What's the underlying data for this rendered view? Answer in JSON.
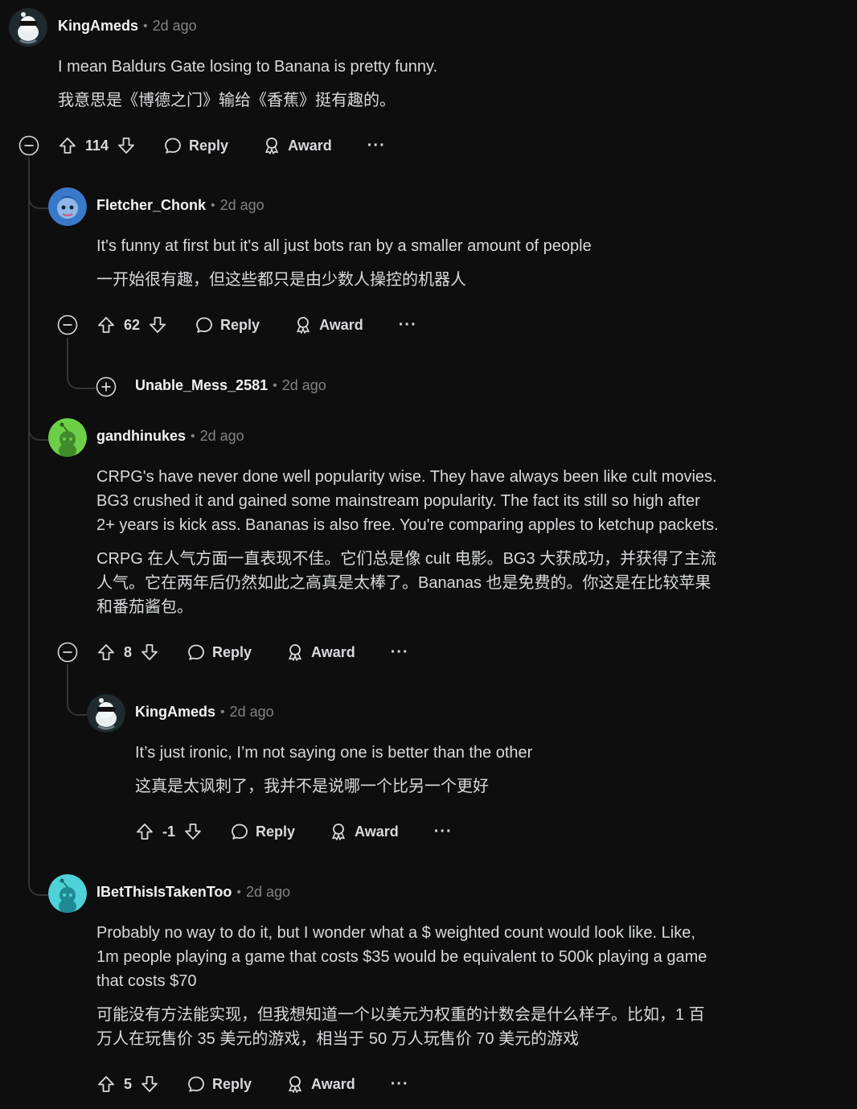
{
  "comments": [
    {
      "user": "KingAmeds",
      "time": "2d ago",
      "text": "I mean Baldurs Gate losing to Banana is pretty funny.",
      "translation": "我意思是《博德之门》输给《香蕉》挺有趣的。",
      "score": "114"
    },
    {
      "user": "Fletcher_Chonk",
      "time": "2d ago",
      "text": "It's funny at first but it's all just bots ran by a smaller amount of people",
      "translation": "一开始很有趣，但这些都只是由少数人操控的机器人",
      "score": "62"
    },
    {
      "user": "Unable_Mess_2581",
      "time": "2d ago"
    },
    {
      "user": "gandhinukes",
      "time": "2d ago",
      "text": [
        "CRPG's have never done well popularity wise. They have always been like cult movies.",
        "BG3 crushed it and gained some mainstream popularity. The fact its still so high after",
        "2+ years is kick ass. Bananas is also free. You're comparing apples to ketchup packets."
      ],
      "translation": [
        "CRPG 在人气方面一直表现不佳。它们总是像 cult 电影。BG3 大获成功，并获得了主流",
        "人气。它在两年后仍然如此之高真是太棒了。Bananas 也是免费的。你这是在比较苹果",
        "和番茄酱包。"
      ],
      "score": "8"
    },
    {
      "user": "KingAmeds",
      "time": "2d ago",
      "text": "It’s just ironic, I’m not saying one is better than the other",
      "translation": "这真是太讽刺了，我并不是说哪一个比另一个更好",
      "score": "-1"
    },
    {
      "user": "IBetThisIsTakenToo",
      "time": "2d ago",
      "text": [
        "Probably no way to do it, but I wonder what a $ weighted count would look like. Like,",
        "1m people playing a game that costs $35 would be equivalent to 500k playing a game",
        "that costs $70"
      ],
      "translation": [
        "可能没有方法能实现，但我想知道一个以美元为权重的计数会是什么样子。比如，1 百",
        "万人在玩售价 35 美元的游戏，相当于 50 万人玩售价 70 美元的游戏"
      ],
      "score": "5"
    }
  ],
  "labels": {
    "reply": "Reply",
    "award": "Award",
    "more": "···",
    "separator": "•"
  },
  "colors": {
    "background": "#0e0e0e",
    "text": "#d7dadc",
    "muted": "#818384",
    "thread_line": "#343536"
  },
  "icons": [
    "upvote-icon",
    "downvote-icon",
    "reply-bubble-icon",
    "award-icon",
    "collapse-icon",
    "expand-icon"
  ]
}
